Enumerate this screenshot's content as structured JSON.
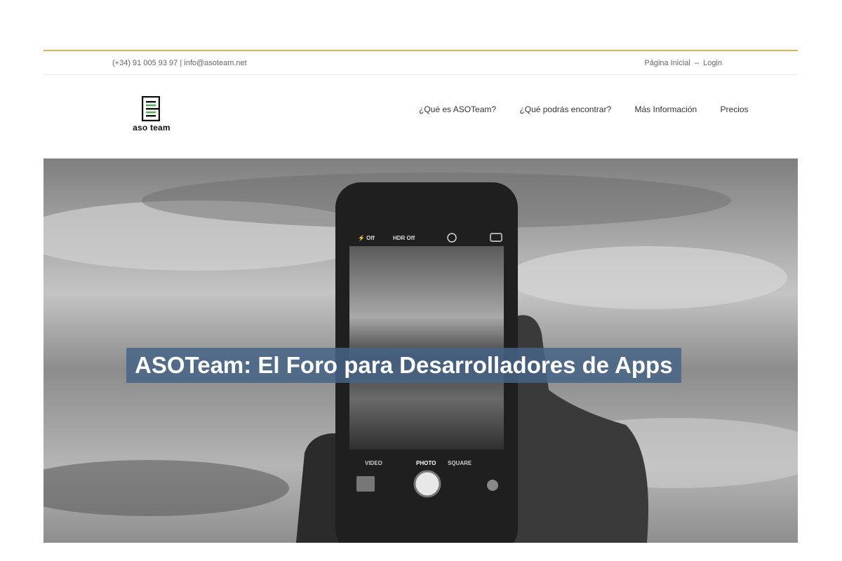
{
  "top_bar": {
    "phone": "(+34) 91 005 93 97",
    "separator": "|",
    "email": "info@asoteam.net",
    "links": {
      "home": "Página Inicial",
      "divider": "–",
      "login": "Login"
    }
  },
  "header": {
    "logo_text": "aso team",
    "nav": [
      {
        "label": "¿Qué es ASOTeam?"
      },
      {
        "label": "¿Qué podrás encontrar?"
      },
      {
        "label": "Más Información"
      },
      {
        "label": "Precios"
      }
    ]
  },
  "hero": {
    "title": "ASOTeam: El Foro para Desarrolladores de Apps",
    "phone_screen": {
      "flash": "⚡ Off",
      "hdr": "HDR Off",
      "modes": [
        "VIDEO",
        "PHOTO",
        "SQUARE"
      ]
    }
  },
  "colors": {
    "accent": "#e0b04a",
    "title_band": "#46648a",
    "logo_green": "#4caf50"
  }
}
